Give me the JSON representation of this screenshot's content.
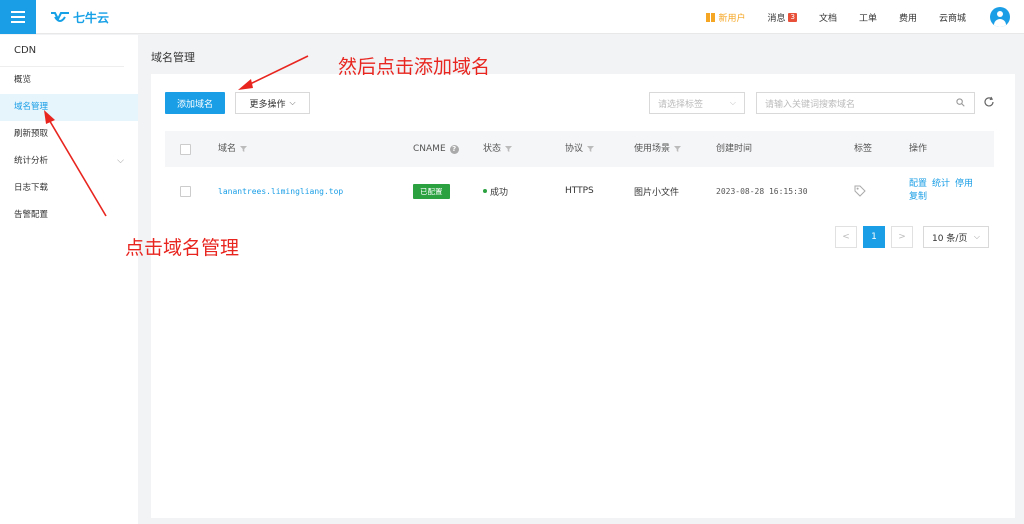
{
  "header": {
    "logo_text": "七牛云",
    "links": [
      {
        "label": "新用户",
        "icon": "gift-icon"
      },
      {
        "label": "消息",
        "badge": "3"
      },
      {
        "label": "文档"
      },
      {
        "label": "工单"
      },
      {
        "label": "费用"
      },
      {
        "label": "云商城"
      }
    ],
    "menu_icon": "hamburger-icon",
    "avatar_icon": "user-avatar-icon"
  },
  "sidebar": {
    "title": "CDN",
    "items": [
      {
        "label": "概览"
      },
      {
        "label": "域名管理",
        "active": true
      },
      {
        "label": "刷新预取"
      },
      {
        "label": "统计分析",
        "expandable": true
      },
      {
        "label": "日志下载"
      },
      {
        "label": "告警配置"
      }
    ]
  },
  "main": {
    "page_title": "域名管理",
    "toolbar": {
      "add_label": "添加域名",
      "more_label": "更多操作",
      "tag_placeholder": "请选择标签",
      "search_placeholder": "请输入关键词搜索域名"
    },
    "table": {
      "headers": {
        "domain": "域名",
        "cname": "CNAME",
        "status": "状态",
        "protocol": "协议",
        "scene": "使用场景",
        "created": "创建时间",
        "tag": "标签",
        "actions": "操作"
      },
      "rows": [
        {
          "domain": "lanantrees.limingliang.top",
          "cname": "已配置",
          "status": "成功",
          "protocol": "HTTPS",
          "scene": "图片小文件",
          "created": "2023-08-28 16:15:30",
          "actions": [
            "配置",
            "统计",
            "停用",
            "复制"
          ]
        }
      ]
    },
    "pagination": {
      "prev": "<",
      "current": "1",
      "next": ">",
      "page_size": "10 条/页"
    }
  },
  "annotations": {
    "top": "然后点击添加域名",
    "left": "点击域名管理"
  },
  "colors": {
    "brand": "#1a9ee6",
    "success": "#2ba140",
    "annotation": "#e8251f",
    "gift": "#f5a623"
  }
}
